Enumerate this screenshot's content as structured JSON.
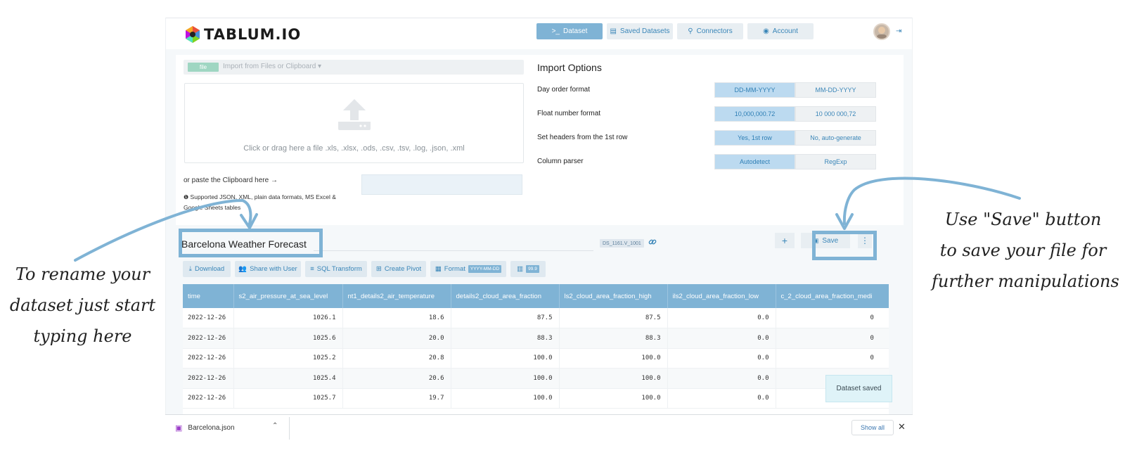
{
  "app": {
    "logo_text": "TABLUM.IO",
    "nav": [
      {
        "label": "Dataset",
        "icon": "terminal-icon",
        "active": true
      },
      {
        "label": "Saved Datasets",
        "icon": "table-icon",
        "active": false
      },
      {
        "label": "Connectors",
        "icon": "plug-icon",
        "active": false
      },
      {
        "label": "Account",
        "icon": "user-circle-icon",
        "active": false
      }
    ]
  },
  "import": {
    "file_badge": "file",
    "file_dropdown": "Import from Files or Clipboard",
    "dropzone_hint": "Click or drag here a file .xls, .xlsx, .ods, .csv, .tsv, .log, .json, .xml",
    "paste_label": "or paste the Clipboard here →",
    "support_note": "Supported JSON, XML, plain data formats, MS Excel & Google Sheets tables"
  },
  "import_options": {
    "title": "Import Options",
    "rows": [
      {
        "label": "Day order format",
        "options": [
          "DD-MM-YYYY",
          "MM-DD-YYYY"
        ],
        "selected": 0
      },
      {
        "label": "Float number format",
        "options": [
          "10,000,000.72",
          "10 000 000,72"
        ],
        "selected": 0
      },
      {
        "label": "Set headers from the 1st row",
        "options": [
          "Yes, 1st row",
          "No, auto-generate"
        ],
        "selected": 0
      },
      {
        "label": "Column parser",
        "options": [
          "Autodetect",
          "RegExp"
        ],
        "selected": 0
      }
    ]
  },
  "dataset": {
    "name": "Barcelona Weather Forecast",
    "id_badge": "DS_1161.V_1001",
    "add_label": "+",
    "save_label": "Save",
    "more_label": "⋮",
    "toolbar": {
      "download": "Download",
      "share": "Share with User",
      "sql": "SQL Transform",
      "pivot": "Create Pivot",
      "format": "Format",
      "format_badge": "YYYY-MM-DD",
      "precision_badge": "99.9"
    }
  },
  "table": {
    "columns": [
      "time",
      "s2_air_pressure_at_sea_level",
      "nt1_details2_air_temperature",
      "details2_cloud_area_fraction",
      "ls2_cloud_area_fraction_high",
      "ils2_cloud_area_fraction_low",
      "c_2_cloud_area_fraction_medi"
    ],
    "rows": [
      [
        "2022-12-26",
        "1026.1",
        "18.6",
        "87.5",
        "87.5",
        "0.0",
        "0"
      ],
      [
        "2022-12-26",
        "1025.6",
        "20.0",
        "88.3",
        "88.3",
        "0.0",
        "0"
      ],
      [
        "2022-12-26",
        "1025.2",
        "20.8",
        "100.0",
        "100.0",
        "0.0",
        "0"
      ],
      [
        "2022-12-26",
        "1025.4",
        "20.6",
        "100.0",
        "100.0",
        "0.0",
        ""
      ],
      [
        "2022-12-26",
        "1025.7",
        "19.7",
        "100.0",
        "100.0",
        "0.0",
        ""
      ]
    ]
  },
  "toast": "Dataset saved",
  "downloads": {
    "file": "Barcelona.json",
    "show_all": "Show all",
    "close": "✕"
  },
  "annotations": {
    "left_lines": [
      "To rename your",
      "dataset just start",
      "typing here"
    ],
    "right_lines": [
      "Use \"Save\" button",
      "to save your file for",
      "further manipulations"
    ]
  },
  "colors": {
    "accent": "#7fb3d5",
    "link": "#3a86b8",
    "highlight": "#7fb3d5"
  }
}
